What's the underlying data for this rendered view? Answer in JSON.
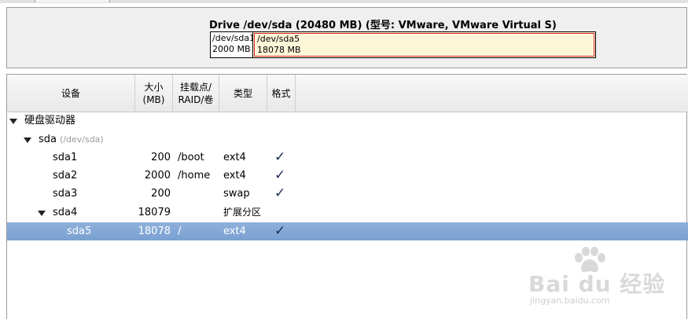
{
  "drive": {
    "title": "Drive /dev/sda (20480 MB) (型号: VMware, VMware Virtual S)",
    "segments": [
      {
        "name": "/dev/sda1",
        "size": "2000 MB"
      },
      {
        "name": "/dev/sda5",
        "size": "18078 MB"
      }
    ]
  },
  "table": {
    "headers": {
      "device": "设备",
      "size_line1": "大小",
      "size_line2": "(MB)",
      "mount_line1": "挂载点/",
      "mount_line2": "RAID/卷",
      "type": "类型",
      "format": "格式"
    },
    "group": {
      "label": "硬盘驱动器"
    },
    "disk": {
      "label": "sda",
      "path": "(/dev/sda)"
    },
    "rows": [
      {
        "device": "sda1",
        "size": "200",
        "mount": "/boot",
        "type": "ext4",
        "format": "✓"
      },
      {
        "device": "sda2",
        "size": "2000",
        "mount": "/home",
        "type": "ext4",
        "format": "✓"
      },
      {
        "device": "sda3",
        "size": "200",
        "mount": "",
        "type": "swap",
        "format": "✓"
      },
      {
        "device": "sda4",
        "size": "18079",
        "mount": "",
        "type": "扩展分区",
        "format": ""
      },
      {
        "device": "sda5",
        "size": "18078",
        "mount": "/",
        "type": "ext4",
        "format": "✓"
      }
    ],
    "selected_row": "sda5"
  },
  "watermark": {
    "brand": "Bai du 经验",
    "url": "jingyan.baidu.com"
  },
  "colors": {
    "selection": "#7aa1d2",
    "segment_fill": "#fdf6d8",
    "segment_border": "#d8262a"
  }
}
